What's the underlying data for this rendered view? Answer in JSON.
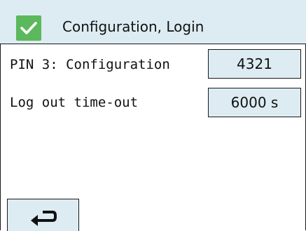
{
  "header": {
    "title": "Configuration, Login",
    "check_icon": "check-icon",
    "check_color": "#5cb85c"
  },
  "rows": [
    {
      "label": "PIN 3: Configuration",
      "value": "4321"
    },
    {
      "label": "Log out time-out",
      "value": "6000 s"
    }
  ],
  "footer": {
    "back_icon": "return-arrow-icon"
  },
  "colors": {
    "panel": "#dcecf2",
    "border": "#1a1a1a",
    "background": "#ffffff"
  }
}
